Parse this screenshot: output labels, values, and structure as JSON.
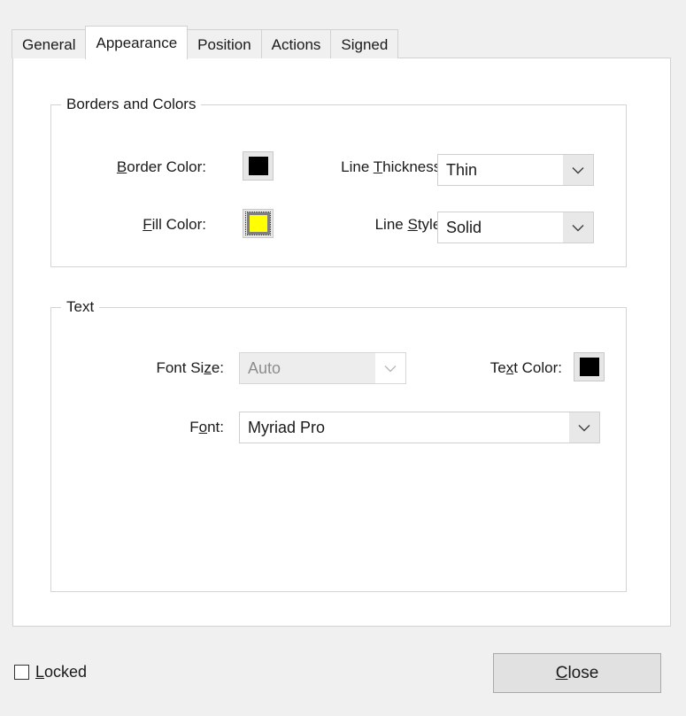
{
  "dialog": {
    "tabs": [
      {
        "label": "General",
        "active": false
      },
      {
        "label": "Appearance",
        "active": true
      },
      {
        "label": "Position",
        "active": false
      },
      {
        "label": "Actions",
        "active": false
      },
      {
        "label": "Signed",
        "active": false
      }
    ]
  },
  "borders_group": {
    "title": "Borders and Colors",
    "border_color": {
      "label_pre": "",
      "label_accel": "B",
      "label_post": "order Color:",
      "swatch_color": "#000000",
      "focused": false
    },
    "fill_color": {
      "label_pre": "",
      "label_accel": "F",
      "label_post": "ill Color:",
      "swatch_color": "#ffff00",
      "focused": true
    },
    "line_thickness": {
      "label_pre": "Line ",
      "label_accel": "T",
      "label_post": "hickness:",
      "value": "Thin",
      "disabled": false
    },
    "line_style": {
      "label_pre": "Line ",
      "label_accel": "S",
      "label_post": "tyle:",
      "value": "Solid",
      "disabled": false
    }
  },
  "text_group": {
    "title": "Text",
    "font_size": {
      "label_pre": "Font Si",
      "label_accel": "z",
      "label_post": "e:",
      "value": "Auto",
      "disabled": true
    },
    "text_color": {
      "label_pre": "Te",
      "label_accel": "x",
      "label_post": "t Color:",
      "swatch_color": "#000000"
    },
    "font": {
      "label_pre": "F",
      "label_accel": "o",
      "label_post": "nt:",
      "value": "Myriad Pro",
      "disabled": false
    }
  },
  "footer": {
    "locked": {
      "label_pre": "",
      "label_accel": "L",
      "label_post": "ocked",
      "checked": false
    },
    "close": {
      "label_pre": "",
      "label_accel": "C",
      "label_post": "lose"
    }
  },
  "icons": {
    "chevron_down": "chevron-down-icon"
  }
}
